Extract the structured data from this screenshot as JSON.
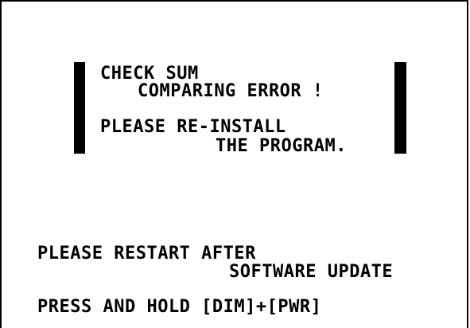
{
  "error_box": {
    "line1": "CHECK SUM",
    "line2": "COMPARING ERROR !",
    "line3": "PLEASE RE-INSTALL",
    "line4": "THE PROGRAM."
  },
  "instructions": {
    "line1": "PLEASE RESTART AFTER",
    "line2": "SOFTWARE UPDATE",
    "line3": "PRESS AND HOLD [DIM]+[PWR]"
  }
}
